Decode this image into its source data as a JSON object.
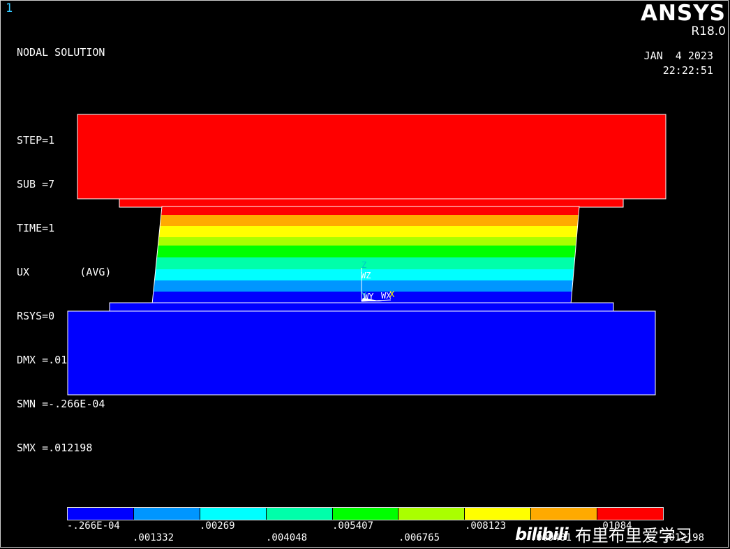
{
  "window_number": "1",
  "info_lines": [
    "NODAL SOLUTION",
    "",
    "STEP=1",
    "SUB =7",
    "TIME=1",
    "UX        (AVG)",
    "RSYS=0",
    "DMX =.012309",
    "SMN =-.266E-04",
    "SMX =.012198"
  ],
  "logo": {
    "brand": "ANSYS",
    "version": "R18.0"
  },
  "date": "JAN  4 2023",
  "time": "22:22:51",
  "triad": {
    "z_label": "Z",
    "wz_label": "WZ",
    "y_label": "Y",
    "wy_label": "WY",
    "wx_label": "WX",
    "x_label": "X"
  },
  "legend": {
    "colors": [
      "#0000ff",
      "#0096ff",
      "#00ffff",
      "#00ffaa",
      "#00ff00",
      "#aaff00",
      "#ffff00",
      "#ffaa00",
      "#ff0000"
    ],
    "labels_top": [
      "-.266E-04",
      ".00269",
      ".005407",
      ".008123",
      ".01084"
    ],
    "labels_bottom": [
      ".001332",
      ".004048",
      ".006765",
      ".009481",
      ".012198"
    ]
  },
  "watermark": {
    "logo": "bilibili",
    "text": "布里布里爱学习"
  }
}
